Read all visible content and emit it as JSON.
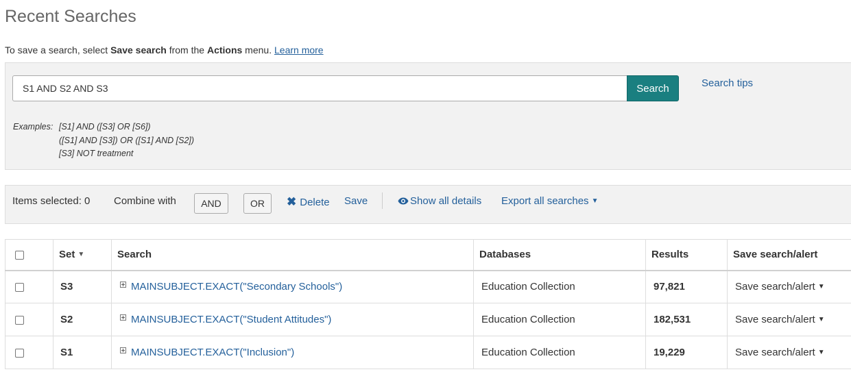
{
  "page": {
    "title": "Recent Searches",
    "intro": {
      "prefix": "To save a search, select ",
      "bold1": "Save search",
      "middle": " from the ",
      "bold2": "Actions",
      "suffix": " menu. ",
      "learn_more": "Learn more"
    }
  },
  "search": {
    "query": "S1 AND S2 AND S3",
    "button_label": "Search",
    "tips_label": "Search tips",
    "examples_label": "Examples:",
    "examples": [
      "[S1] AND ([S3] OR [S6])",
      "([S1] AND [S3]) OR ([S1] AND [S2])",
      "[S3] NOT treatment"
    ]
  },
  "toolbar": {
    "items_selected": "Items selected: 0",
    "combine_label": "Combine with",
    "and_label": "AND",
    "or_label": "OR",
    "delete_label": "Delete",
    "save_label": "Save",
    "show_details_label": "Show all details",
    "export_label": "Export all searches"
  },
  "table": {
    "headers": {
      "set": "Set",
      "search": "Search",
      "databases": "Databases",
      "results": "Results",
      "save_alert": "Save search/alert"
    },
    "rows": [
      {
        "set": "S3",
        "query": "MAINSUBJECT.EXACT(\"Secondary Schools\")",
        "database": "Education Collection",
        "results": "97,821",
        "action": "Save search/alert"
      },
      {
        "set": "S2",
        "query": "MAINSUBJECT.EXACT(\"Student Attitudes\")",
        "database": "Education Collection",
        "results": "182,531",
        "action": "Save search/alert"
      },
      {
        "set": "S1",
        "query": "MAINSUBJECT.EXACT(\"Inclusion\")",
        "database": "Education Collection",
        "results": "19,229",
        "action": "Save search/alert"
      }
    ]
  },
  "colors": {
    "link": "#24609b",
    "search_button": "#1a7f80",
    "panel_bg": "#f2f2f2"
  }
}
